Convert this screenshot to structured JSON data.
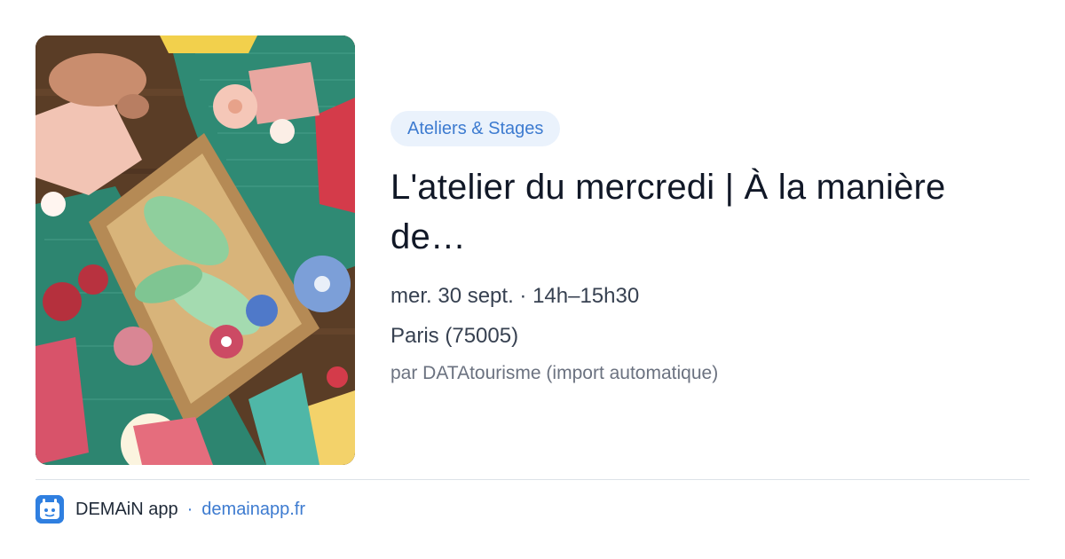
{
  "event": {
    "category_badge": "Ateliers & Stages",
    "title": "L'atelier du mercredi | À la manière de…",
    "datetime": "mer. 30 sept. · 14h–15h30",
    "location": "Paris (75005)",
    "source": "par DATAtourisme (import automatique)"
  },
  "footer": {
    "app_name": "DEMAiN app",
    "separator": "·",
    "url": "demainapp.fr"
  },
  "image": {
    "icon": "paper-craft-photo"
  },
  "colors": {
    "accent": "#3d7bd0",
    "badge_bg": "#eaf2fc",
    "title": "#111827",
    "logo_bg": "#2f7fe0"
  }
}
